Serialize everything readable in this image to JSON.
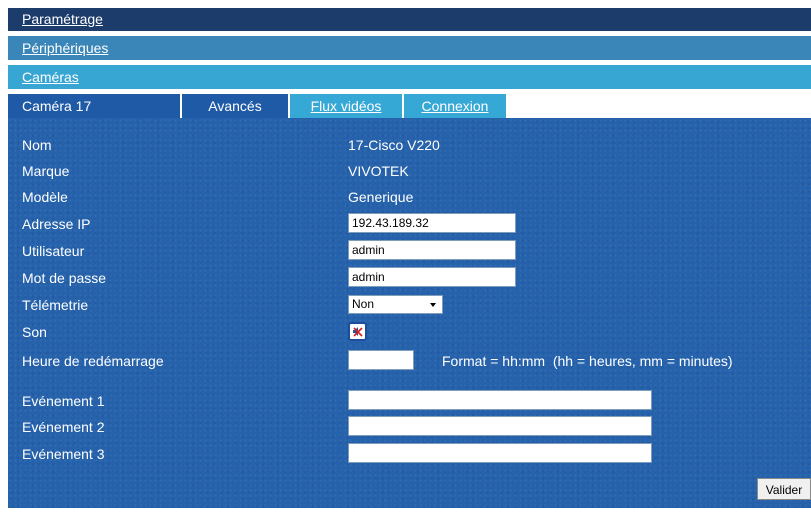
{
  "nav": {
    "settings": "Paramétrage",
    "devices": "Périphériques",
    "cameras": "Caméras"
  },
  "tabs": {
    "camera": "Caméra 17",
    "advanced": "Avancés",
    "streams": "Flux vidéos",
    "connection": "Connexion"
  },
  "form": {
    "name_label": "Nom",
    "name_value": "17-Cisco V220",
    "brand_label": "Marque",
    "brand_value": "VIVOTEK",
    "model_label": "Modèle",
    "model_value": "Generique",
    "ip_label": "Adresse IP",
    "ip_value": "192.43.189.32",
    "user_label": "Utilisateur",
    "user_value": "admin",
    "password_label": "Mot de passe",
    "password_value": "admin",
    "telemetry_label": "Télémetrie",
    "telemetry_value": "Non",
    "sound_label": "Son",
    "sound_icon": "speaker-muted-icon",
    "restart_label": "Heure de redémarrage",
    "restart_value": "",
    "restart_hint": "Format = hh:mm  (hh = heures, mm = minutes)",
    "event1_label": "Evénement 1",
    "event1_value": "",
    "event2_label": "Evénement 2",
    "event2_value": "",
    "event3_label": "Evénement 3",
    "event3_value": "",
    "submit_label": "Valider"
  },
  "colors": {
    "nav_dark": "#1c3c6c",
    "nav_mid": "#3a86b8",
    "nav_light": "#38a6d2",
    "panel": "#2562ab"
  }
}
